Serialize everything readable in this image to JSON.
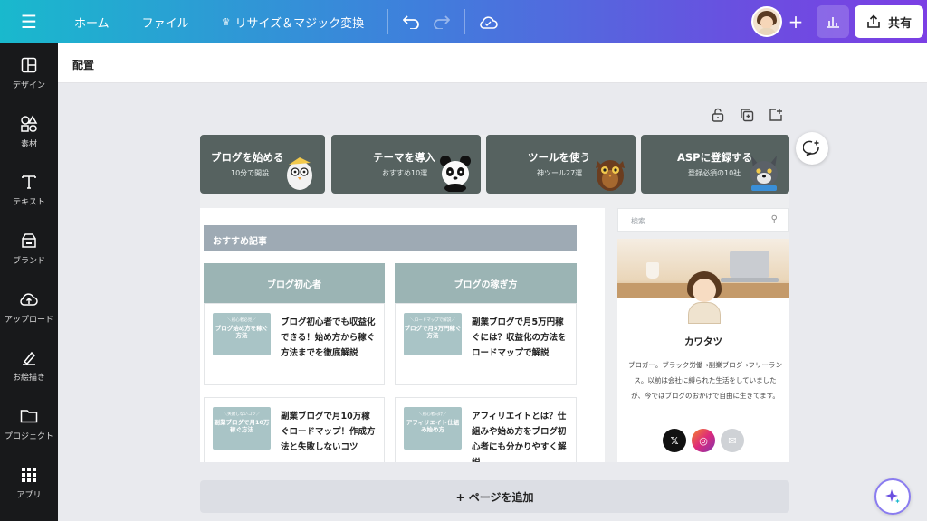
{
  "topbar": {
    "menu_icon": "hamburger-icon",
    "home": "ホーム",
    "file": "ファイル",
    "resize": "リサイズ＆マジック変換",
    "share": "共有"
  },
  "sidebar": {
    "items": [
      {
        "label": "デザイン",
        "icon": "layout-icon"
      },
      {
        "label": "素材",
        "icon": "shapes-icon"
      },
      {
        "label": "テキスト",
        "icon": "text-icon"
      },
      {
        "label": "ブランド",
        "icon": "brand-icon"
      },
      {
        "label": "アップロード",
        "icon": "upload-icon"
      },
      {
        "label": "お絵描き",
        "icon": "draw-icon"
      },
      {
        "label": "プロジェクト",
        "icon": "folder-icon"
      },
      {
        "label": "アプリ",
        "icon": "apps-icon"
      }
    ]
  },
  "subheader": {
    "title": "配置"
  },
  "canvas": {
    "categories": [
      {
        "title": "ブログを始める",
        "sub": "10分で開設"
      },
      {
        "title": "テーマを導入",
        "sub": "おすすめ10選"
      },
      {
        "title": "ツールを使う",
        "sub": "神ツール27選"
      },
      {
        "title": "ASPに登録する",
        "sub": "登録必須の10社"
      }
    ],
    "recommended": "おすすめ記事",
    "columns": [
      "ブログ初心者",
      "ブログの稼ぎ方"
    ],
    "articles": [
      {
        "thumb_small": "＼初心者必見／",
        "thumb": "ブログ始め方を稼ぐ方法",
        "text": "ブログ初心者でも収益化できる！始め方から稼ぐ方法までを徹底解説"
      },
      {
        "thumb_small": "＼ロードマップで解説／",
        "thumb": "ブログで月5万円稼ぐ方法",
        "text": "副業ブログで月5万円稼ぐには？収益化の方法をロードマップで解説"
      },
      {
        "thumb_small": "＼失敗しないコツ／",
        "thumb": "副業ブログで月10万稼ぐ方法",
        "text": "副業ブログで月10万稼ぐロードマップ！作成方法と失敗しないコツ"
      },
      {
        "thumb_small": "＼初心者向け／",
        "thumb": "アフィリエイト仕組み始め方",
        "text": "アフィリエイトとは？仕組みや始め方をブログ初心者にも分かりやすく解説"
      }
    ],
    "search_placeholder": "検索",
    "profile": {
      "name": "カワタツ",
      "desc": "ブロガー。ブラック労働→副業ブログ→フリーランス。以前は会社に縛られた生活をしていましたが、今ではブログのおかげで自由に生きてます。",
      "socials": [
        {
          "icon": "x-icon",
          "glyph": "𝕏",
          "color": "#111111"
        },
        {
          "icon": "instagram-icon",
          "glyph": "◎",
          "color": "#e1306c"
        },
        {
          "icon": "mail-icon",
          "glyph": "✉",
          "color": "#cfd2d6"
        }
      ]
    }
  },
  "add_page": "+ ページを追加",
  "colors": {
    "accent_start": "#19b9cd",
    "accent_end": "#7b3fe4",
    "category_bg": "#566260",
    "column_bg": "#9bb4b4"
  }
}
